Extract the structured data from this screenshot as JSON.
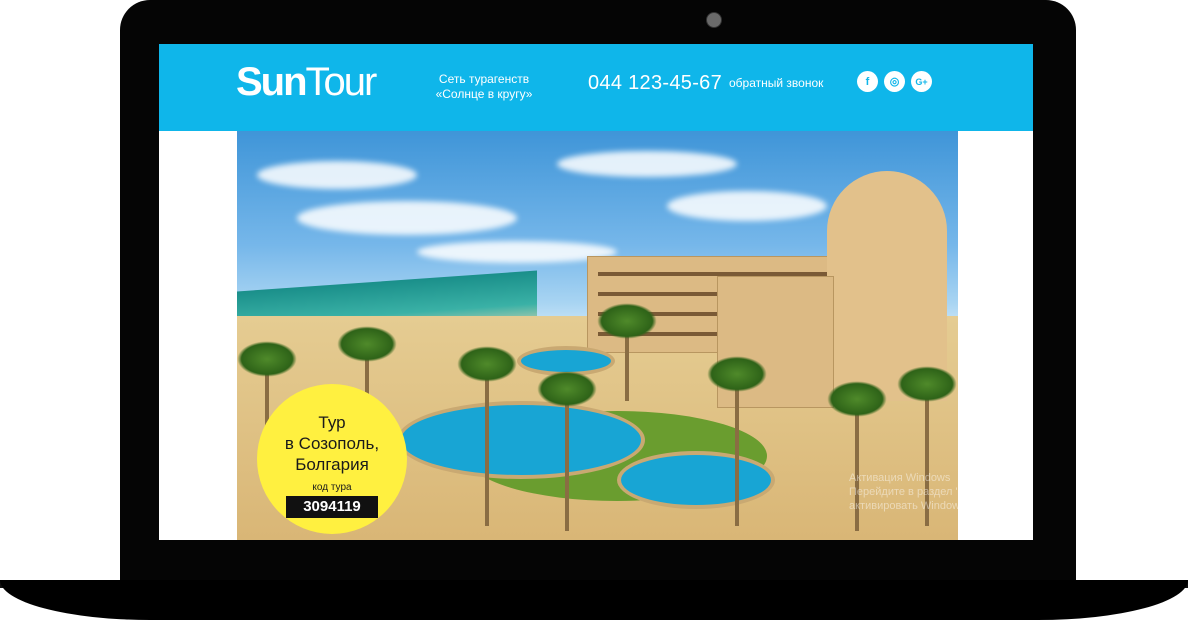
{
  "header": {
    "logo": {
      "part1": "Sun",
      "part2": "Tour"
    },
    "tagline": "Сеть турагенств\n«Солнце в кругу»",
    "phone": "044 123-45-67",
    "callback_label": "обратный звонок",
    "socials": [
      {
        "icon": "facebook-icon",
        "glyph": "f"
      },
      {
        "icon": "instagram-icon",
        "glyph": "◎"
      },
      {
        "icon": "google-plus-icon",
        "glyph": "G+"
      }
    ]
  },
  "hero": {
    "badge": {
      "title": "Тур\nв Созополь,\nБолгария",
      "code_label": "код тура",
      "code": "3094119"
    },
    "watermark": {
      "line1": "Активация Windows",
      "line2": "Перейдите в раздел \"Настройки\", щоб",
      "line3": "активировать Windows."
    }
  },
  "colors": {
    "header_bg": "#0fb6ea",
    "badge_bg": "#fff040",
    "laptop": "#050505"
  }
}
